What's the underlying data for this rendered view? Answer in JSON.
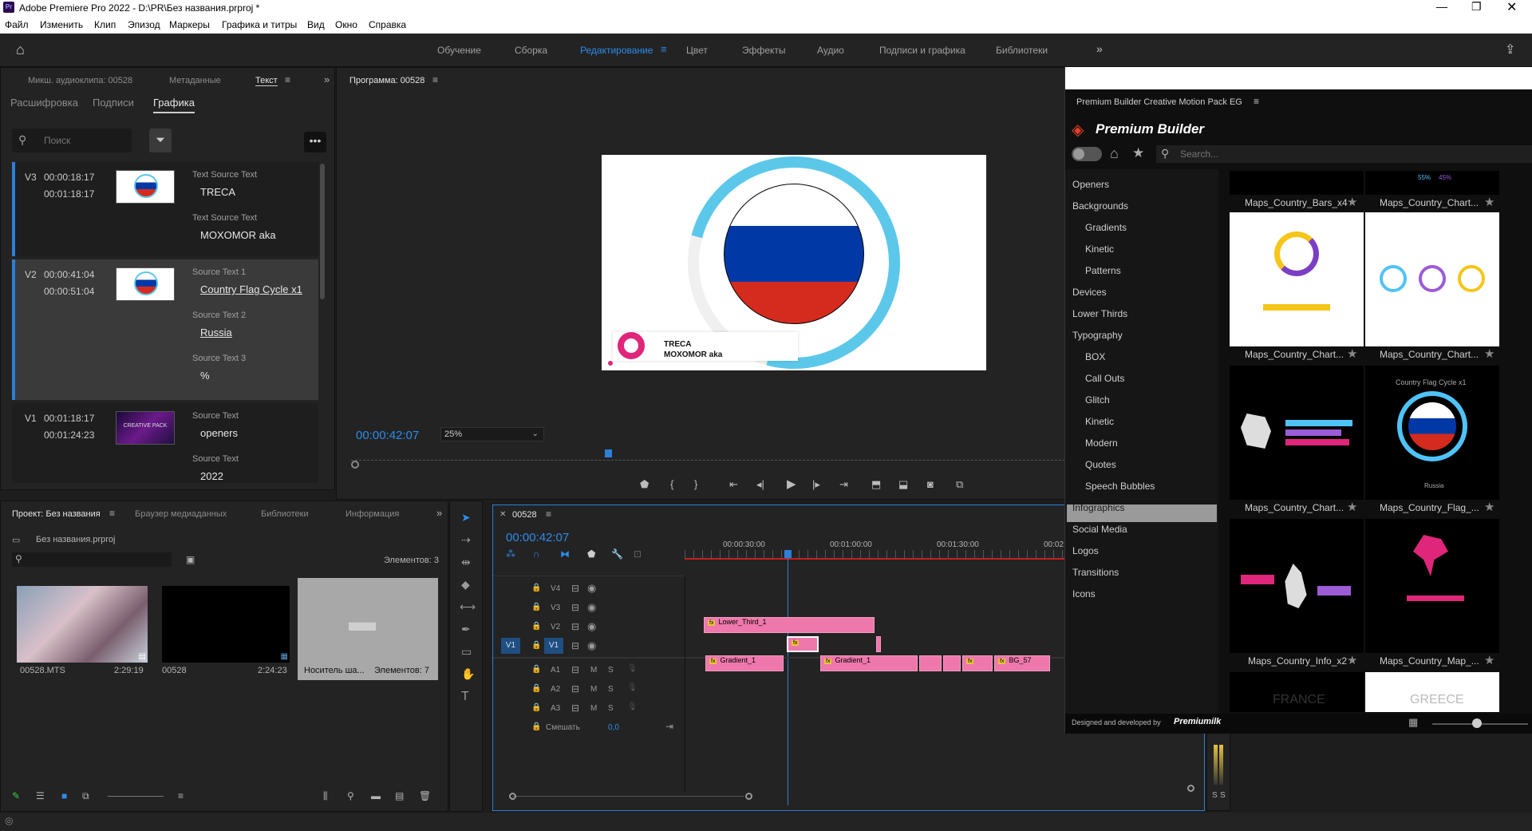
{
  "titlebar": {
    "title": "Adobe Premiere Pro 2022 - D:\\PR\\Без названия.prproj *",
    "app_icon": "Pr"
  },
  "menu": [
    "Файл",
    "Изменить",
    "Клип",
    "Эпизод",
    "Маркеры",
    "Графика и титры",
    "Вид",
    "Окно",
    "Справка"
  ],
  "workspaces": [
    "Обучение",
    "Сборка",
    "Редактирование",
    "Цвет",
    "Эффекты",
    "Аудио",
    "Подписи и графика",
    "Библиотеки"
  ],
  "active_workspace": "Редактирование",
  "text_panel": {
    "tabs": [
      "Микш. аудиоклипа: 00528",
      "Метаданные",
      "Текст"
    ],
    "subtabs": [
      "Расшифровка",
      "Подписи",
      "Графика"
    ],
    "search_placeholder": "Поиск",
    "rows": [
      {
        "track": "V3",
        "in": "00:00:18:17",
        "out": "00:01:18:17",
        "fields": [
          {
            "label": "Text Source Text",
            "value": "TRECA"
          },
          {
            "label": "Text Source Text",
            "value": "MOXOMOR aka"
          }
        ]
      },
      {
        "track": "V2",
        "in": "00:00:41:04",
        "out": "00:00:51:04",
        "fields": [
          {
            "label": "Source Text 1",
            "value": "Country Flag Cycle x1"
          },
          {
            "label": "Source Text 2",
            "value": "Russia"
          },
          {
            "label": "Source Text 3",
            "value": "%"
          }
        ]
      },
      {
        "track": "V1",
        "in": "00:01:18:17",
        "out": "00:01:24:23",
        "fields": [
          {
            "label": "Source Text",
            "value": "openers"
          },
          {
            "label": "Source Text",
            "value": "2022"
          }
        ]
      }
    ],
    "thumb_text": "CREATIVE PACK"
  },
  "program": {
    "title": "Программа: 00528",
    "timecode": "00:00:42:07",
    "zoom": "25%",
    "overlay_line1": "TRECA",
    "overlay_line2": "MOXOMOR aka"
  },
  "project": {
    "tabs": [
      "Проект: Без названия",
      "Браузер медиаданных",
      "Библиотеки",
      "Информация"
    ],
    "file": "Без названия.prproj",
    "count": "Элементов: 3",
    "items": [
      {
        "name": "00528.MTS",
        "dur": "2:29:19"
      },
      {
        "name": "00528",
        "dur": "2:24:23"
      },
      {
        "name": "Носитель ша...",
        "dur": "Элементов: 7"
      }
    ]
  },
  "timeline": {
    "title": "00528",
    "timecode": "00:00:42:07",
    "ruler": [
      "00:00:30:00",
      "00:01:00:00",
      "00:01:30:00",
      "00:02"
    ],
    "video_tracks": [
      "V4",
      "V3",
      "V2",
      "V1"
    ],
    "audio_tracks": [
      "A1",
      "A2",
      "A3"
    ],
    "source_patch": "V1",
    "mix_label": "Смешать",
    "mix_value": "0,0",
    "clips": {
      "v3": "Lower_Third_1",
      "v1a": "Gradient_1",
      "v1b": "Gradient_1",
      "v1c": "BG_57"
    },
    "m": "M",
    "s": "S"
  },
  "premium_builder": {
    "panel_title": "Premium Builder Creative Motion Pack EG",
    "logo": "Premium Builder",
    "search_placeholder": "Search...",
    "categories": [
      {
        "name": "Openers",
        "sub": false
      },
      {
        "name": "Backgrounds",
        "sub": false
      },
      {
        "name": "Gradients",
        "sub": true
      },
      {
        "name": "Kinetic",
        "sub": true
      },
      {
        "name": "Patterns",
        "sub": true
      },
      {
        "name": "Devices",
        "sub": false
      },
      {
        "name": "Lower Thirds",
        "sub": false
      },
      {
        "name": "Typography",
        "sub": false
      },
      {
        "name": "BOX",
        "sub": true
      },
      {
        "name": "Call Outs",
        "sub": true
      },
      {
        "name": "Glitch",
        "sub": true
      },
      {
        "name": "Kinetic",
        "sub": true
      },
      {
        "name": "Modern",
        "sub": true
      },
      {
        "name": "Quotes",
        "sub": true
      },
      {
        "name": "Speech Bubbles",
        "sub": true
      },
      {
        "name": "Infographics",
        "sub": false
      },
      {
        "name": "Social Media",
        "sub": false
      },
      {
        "name": "Logos",
        "sub": false
      },
      {
        "name": "Transitions",
        "sub": false
      },
      {
        "name": "Icons",
        "sub": false
      }
    ],
    "selected_category": "Infographics",
    "tiles": [
      "Maps_Country_Bars_x4",
      "Maps_Country_Chart...",
      "Maps_Country_Chart...",
      "Maps_Country_Chart...",
      "Maps_Country_Chart...",
      "Maps_Country_Flag_...",
      "Maps_Country_Info_x2",
      "Maps_Country_Map_..."
    ],
    "tile_texts": {
      "flag_title": "Country Flag Cycle x1",
      "flag_caption": "Russia",
      "france": "FRANCE",
      "greece": "GREECE",
      "pct1": "55%",
      "pct2": "45%"
    },
    "footer": "Designed and developed by",
    "footer_brand": "Premiumilk"
  },
  "meter": {
    "s1": "S",
    "s2": "S"
  },
  "colors": {
    "accent": "#2d8ceb",
    "clip": "#ee78ab",
    "playhead": "#2d7fd8",
    "russia_blue": "#0039a6",
    "russia_red": "#d52b1e",
    "ring": "#5bc8ea"
  }
}
